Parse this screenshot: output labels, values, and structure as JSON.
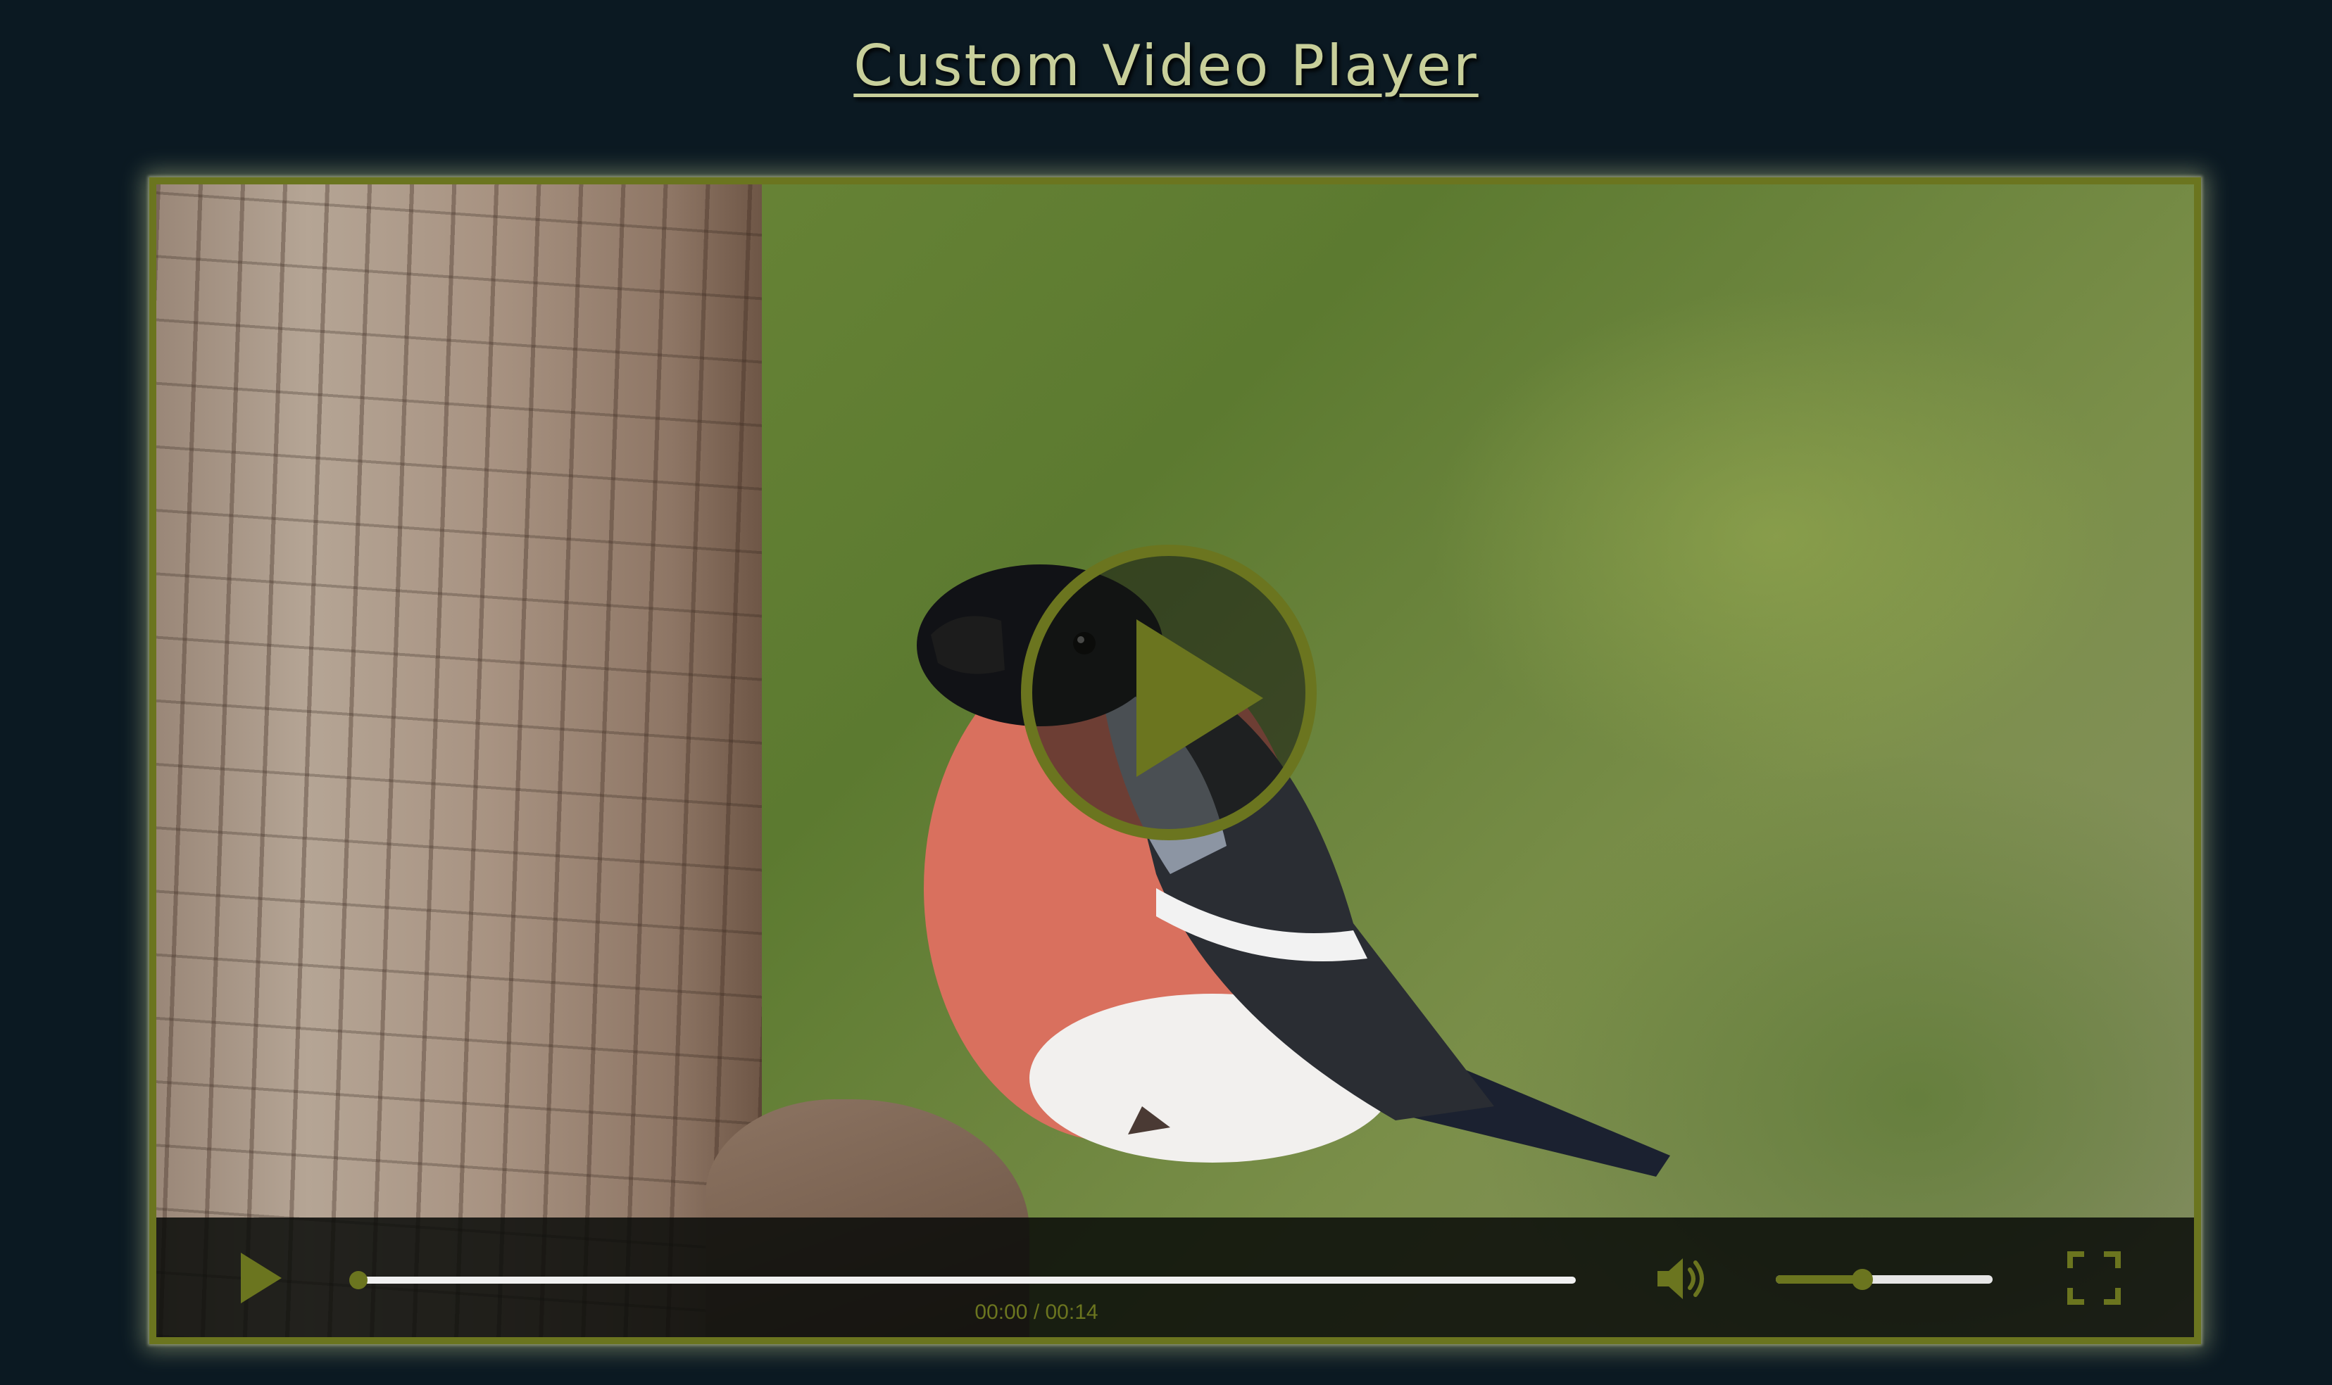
{
  "page": {
    "title": "Custom Video Player"
  },
  "player": {
    "big_play_icon": "play-icon",
    "controls": {
      "play_icon": "play-icon",
      "current_time": "00:00",
      "duration": "00:14",
      "time_separator": " / ",
      "progress_fraction": 0.0,
      "volume_icon": "volume-icon",
      "volume_fraction": 0.4,
      "fullscreen_icon": "fullscreen-icon"
    }
  },
  "colors": {
    "background": "#0b1922",
    "accent": "#6b751f",
    "title": "#c8cf9a",
    "track": "#f1f1f1"
  }
}
